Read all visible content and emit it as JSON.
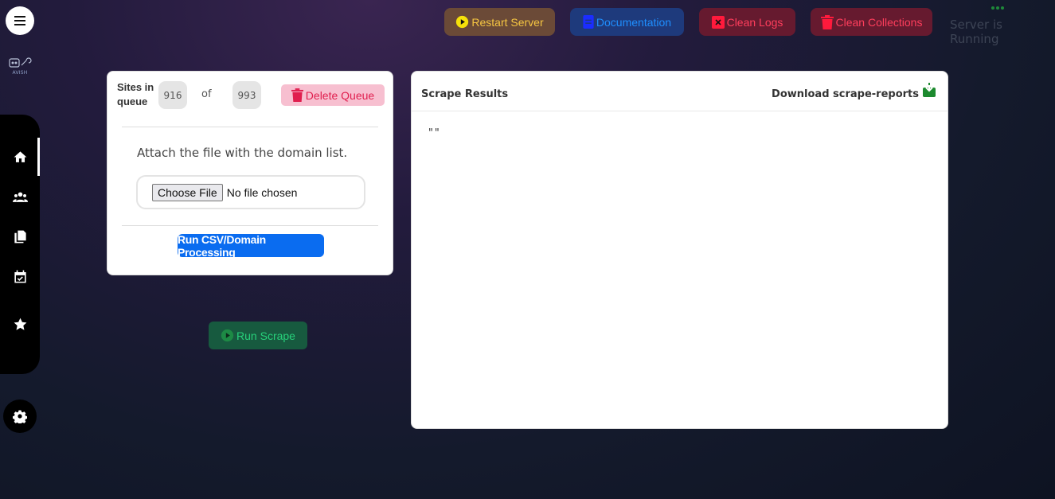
{
  "top_buttons": {
    "restart": "Restart Server",
    "docs": "Documentation",
    "clean_logs": "Clean Logs",
    "clean_collections": "Clean Collections"
  },
  "server_status": "Server is Running",
  "logo_text": "AVISH",
  "queue": {
    "label": "Sites in queue",
    "current": "916",
    "of": "of",
    "total": "993",
    "delete_label": "Delete Queue",
    "attach_label": "Attach the file with the domain list.",
    "choose_file": "Choose File",
    "no_file": "No file chosen",
    "run_csv": "Run CSV/Domain Processing"
  },
  "run_scrape": "Run Scrape",
  "results": {
    "title": "Scrape Results",
    "download": "Download scrape-reports",
    "body": "\"\""
  },
  "sidebar": {
    "items": [
      {
        "icon": "home-icon",
        "active": true
      },
      {
        "icon": "users-icon",
        "active": false
      },
      {
        "icon": "copy-icon",
        "active": false
      },
      {
        "icon": "calendar-check-icon",
        "active": false
      },
      {
        "icon": "star-icon",
        "active": false
      }
    ]
  },
  "colors": {
    "restart_bg": "#6b4a37",
    "restart_fg": "#f5c542",
    "docs_bg": "#1e3a7c",
    "docs_fg": "#1e8fff",
    "danger_bg": "#661a2f",
    "danger_fg": "#ff3e5c",
    "primary": "#0a6cf0",
    "success_fg": "#27d07a"
  }
}
